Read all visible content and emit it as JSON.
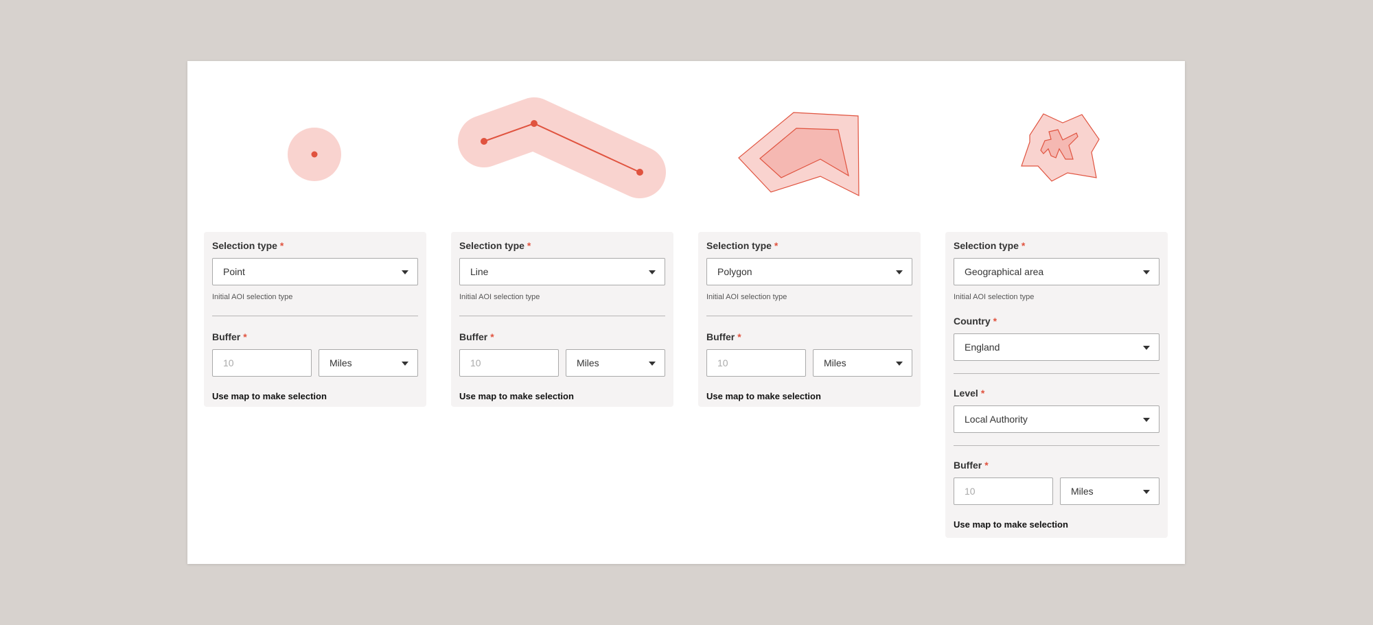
{
  "panels": [
    {
      "selection_label": "Selection type",
      "selection_value": "Point",
      "helper": "Initial AOI selection type",
      "buffer_label": "Buffer",
      "buffer_placeholder": "10",
      "unit": "Miles",
      "action": "Use map to make selection"
    },
    {
      "selection_label": "Selection type",
      "selection_value": "Line",
      "helper": "Initial AOI selection type",
      "buffer_label": "Buffer",
      "buffer_placeholder": "10",
      "unit": "Miles",
      "action": "Use map to make selection"
    },
    {
      "selection_label": "Selection type",
      "selection_value": "Polygon",
      "helper": "Initial AOI selection type",
      "buffer_label": "Buffer",
      "buffer_placeholder": "10",
      "unit": "Miles",
      "action": "Use map to make selection"
    },
    {
      "selection_label": "Selection type",
      "selection_value": "Geographical area",
      "helper": "Initial AOI selection type",
      "country_label": "Country",
      "country_value": "England",
      "level_label": "Level",
      "level_value": "Local Authority",
      "buffer_label": "Buffer",
      "buffer_placeholder": "10",
      "unit": "Miles",
      "action": "Use map to make selection"
    }
  ],
  "required_mark": "*",
  "colors": {
    "accent": "#e0533f",
    "buffer_fill": "#f9d3cf",
    "shape_fill": "#f5b8b2",
    "background": "#d7d2ce",
    "panel": "#f5f3f3"
  },
  "icons": [
    "point-buffer-icon",
    "line-buffer-icon",
    "polygon-buffer-icon",
    "geographic-area-icon"
  ]
}
